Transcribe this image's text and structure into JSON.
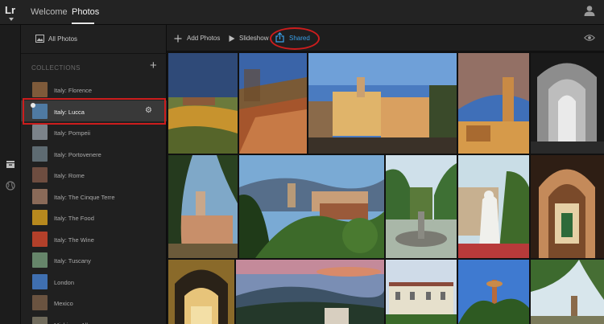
{
  "app": {
    "logo_text": "Lr"
  },
  "nav": {
    "tabs": [
      {
        "label": "Welcome"
      },
      {
        "label": "Photos"
      }
    ]
  },
  "sidebar": {
    "all_photos_label": "All Photos",
    "collections_title": "COLLECTIONS",
    "add_label": "+",
    "items": [
      {
        "label": "Italy: Florence",
        "thumb": "#7e5a3a"
      },
      {
        "label": "Italy: Lucca",
        "thumb": "#4f7aa2"
      },
      {
        "label": "Italy: Pompeii",
        "thumb": "#7c838a"
      },
      {
        "label": "Italy: Portovenere",
        "thumb": "#5e6b72"
      },
      {
        "label": "Italy: Rome",
        "thumb": "#6e4d40"
      },
      {
        "label": "Italy: The Cinque Terre",
        "thumb": "#8a6a58"
      },
      {
        "label": "Italy: The Food",
        "thumb": "#b7891e"
      },
      {
        "label": "Italy: The Wine",
        "thumb": "#b3402a"
      },
      {
        "label": "Italy: Tuscany",
        "thumb": "#66856a"
      },
      {
        "label": "London",
        "thumb": "#3f6fb0"
      },
      {
        "label": "Mexico",
        "thumb": "#6a5340"
      },
      {
        "label": "Michigan: Allegan",
        "thumb": "#6f6a5b"
      }
    ]
  },
  "toolbar": {
    "add_photos_label": "Add Photos",
    "slideshow_label": "Slideshow",
    "shared_label": "Shared"
  },
  "colors": {
    "highlight_red": "#cc1d1d",
    "shared_accent": "#3aa0e8"
  }
}
